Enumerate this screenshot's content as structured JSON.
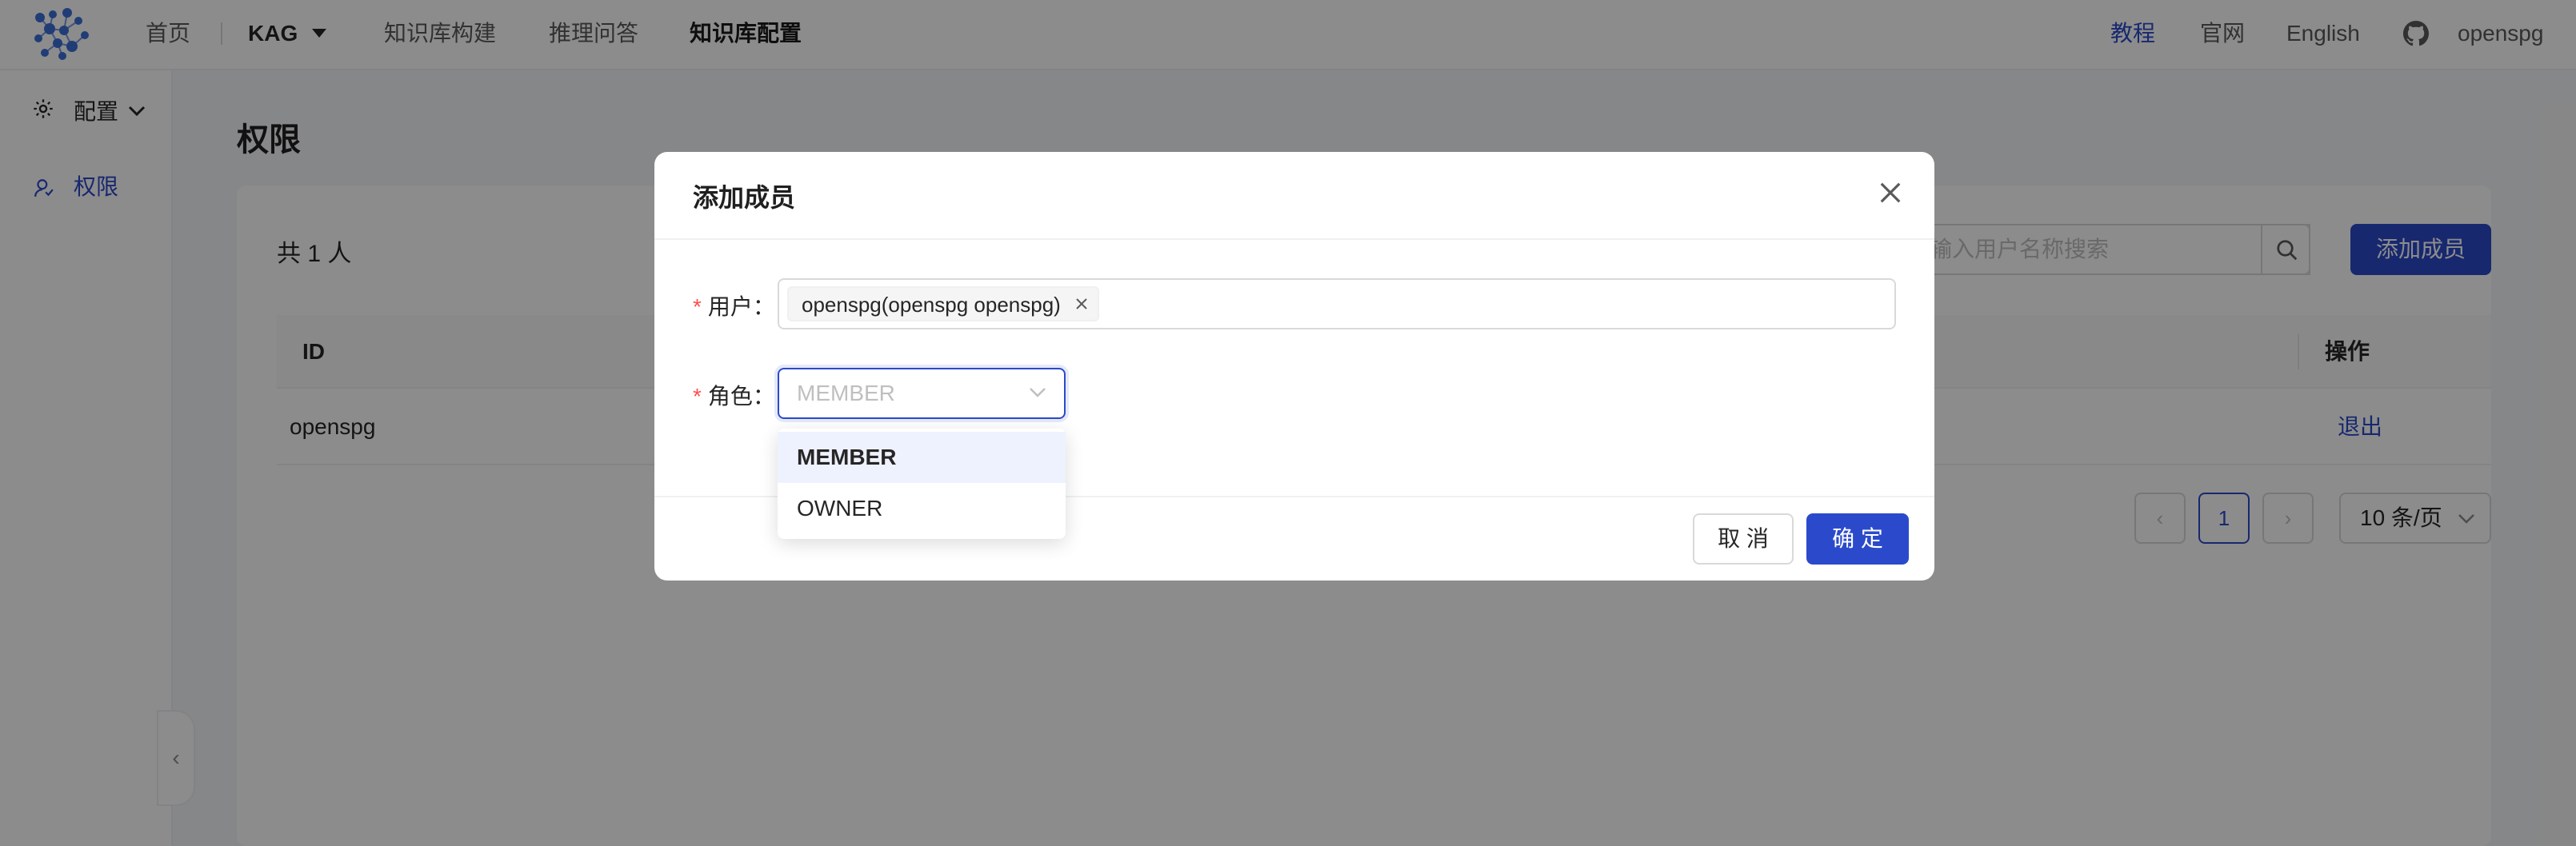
{
  "topnav": {
    "items": [
      {
        "label": "首页"
      },
      {
        "label": "KAG"
      },
      {
        "label": "知识库构建"
      },
      {
        "label": "推理问答"
      },
      {
        "label": "知识库配置"
      }
    ],
    "right": {
      "tutorial": "教程",
      "official_site": "官网",
      "language": "English",
      "username": "openspg"
    }
  },
  "sidebar": {
    "header": "配置",
    "items": [
      {
        "label": "权限",
        "icon": "permission-icon"
      }
    ],
    "collapse_glyph": "‹"
  },
  "main": {
    "title": "权限",
    "total": "共 1 人",
    "search_placeholder": "请输入用户名称搜索",
    "search_visible_text": "输入用户名称搜索",
    "add_button": "添加成员",
    "columns": [
      "ID",
      "操作"
    ],
    "rows": [
      {
        "id": "openspg",
        "action": "退出"
      }
    ],
    "pagination": {
      "prev": "‹",
      "current": "1",
      "next": "›",
      "page_size": "10 条/页"
    }
  },
  "modal": {
    "title": "添加成员",
    "user_label": "用户",
    "user_tag": "openspg(openspg openspg)",
    "role_label": "角色",
    "role_placeholder": "MEMBER",
    "role_options": [
      "MEMBER",
      "OWNER"
    ],
    "role_highlighted": "MEMBER",
    "cancel": "取 消",
    "ok": "确 定",
    "required_mark": "*",
    "label_colon": "："
  },
  "colors": {
    "primary": "#2b4acb",
    "required": "#ff4d4f",
    "mask": "rgba(0,0,0,0.45)"
  }
}
